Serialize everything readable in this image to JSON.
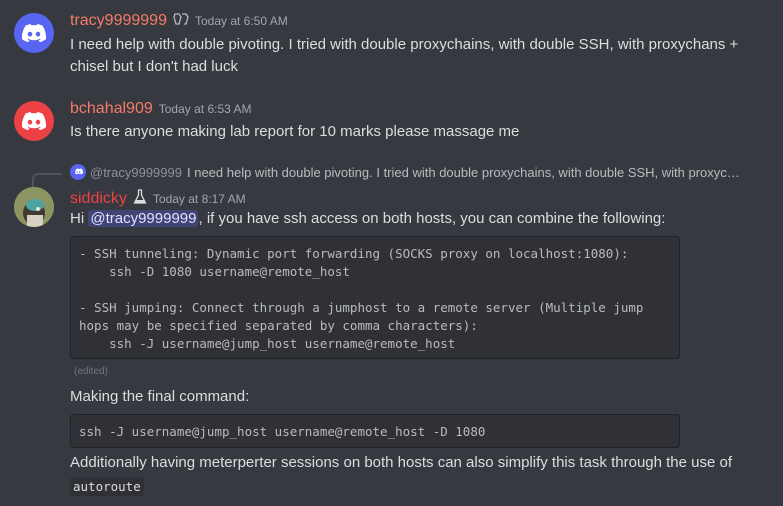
{
  "messages": [
    {
      "username": "tracy9999999",
      "username_color": "#f47b67",
      "timestamp": "Today at 6:50 AM",
      "badge_icon": "nitro-badge-icon",
      "text": "I need help with double pivoting. I tried with double proxychains, with double SSH, with proxychans + chisel but I don't had luck",
      "text_line1": "I need help with double pivoting. I tried with double proxychains, with double SSH, with proxychans +",
      "text_line2": "chisel but I don't had luck"
    },
    {
      "username": "bchahal909",
      "username_color": "#f47b67",
      "timestamp": "Today at 6:53 AM",
      "text": "Is there anyone making lab report for 10 marks please massage me"
    },
    {
      "reply": {
        "mention": "@tracy9999999",
        "preview": "I need help with double pivoting. I tried with double proxychains, with double SSH, with proxyc…"
      },
      "username": "siddicky",
      "username_color": "#ed4245",
      "timestamp": "Today at 8:17 AM",
      "badge_icon": "flask-icon",
      "intro_prefix": "Hi ",
      "mention": "@tracy9999999",
      "intro_suffix": ", if you have ssh access on both hosts, you can combine the following:",
      "code_block_1": "- SSH tunneling: Dynamic port forwarding (SOCKS proxy on localhost:1080):\n    ssh -D 1080 username@remote_host\n\n- SSH jumping: Connect through a jumphost to a remote server (Multiple jump\nhops may be specified separated by comma characters):\n    ssh -J username@jump_host username@remote_host",
      "edited": "(edited)",
      "final_label": "Making the final command:",
      "code_block_2": "ssh -J username@jump_host username@remote_host -D 1080",
      "closing_text": "Additionally having meterperter sessions on both hosts can also simplify this task through the use of",
      "closing_code": "autoroute"
    }
  ],
  "colors": {
    "background": "#36393f",
    "discord_blurple": "#5865f2",
    "discord_red": "#ed4245"
  }
}
